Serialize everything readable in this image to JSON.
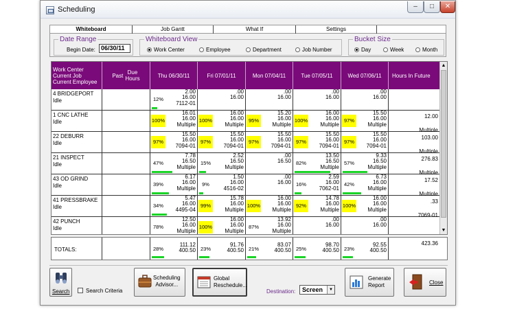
{
  "window": {
    "title": "Scheduling",
    "min": "–",
    "max": "□",
    "close": "✕"
  },
  "tabs": [
    {
      "label": "Whiteboard"
    },
    {
      "label": "Job Gantt"
    },
    {
      "label": "What If"
    },
    {
      "label": "Settings"
    }
  ],
  "date_range": {
    "legend": "Date Range",
    "begin_label": "Begin Date:",
    "begin_value": "06/30/11"
  },
  "view": {
    "legend": "Whiteboard View",
    "options": [
      "Work Center",
      "Employee",
      "Department",
      "Job Number"
    ],
    "selected": "Work Center"
  },
  "bucket": {
    "legend": "Bucket Size",
    "options": [
      "Day",
      "Week",
      "Month"
    ],
    "selected": "Day"
  },
  "grid": {
    "header": {
      "col0": [
        "Work Center",
        "Current Job",
        "Current Employee"
      ],
      "past": "Past",
      "due_hours": [
        "Due",
        "Hours"
      ],
      "days": [
        "Thu 06/30/11",
        "Fri 07/01/11",
        "Mon 07/04/11",
        "Tue 07/05/11",
        "Wed 07/06/11"
      ],
      "future": "Hours In Future"
    },
    "rows": [
      {
        "name": "4 BRIDGEPORT",
        "status": "Idle",
        "days": [
          {
            "pct": "12%",
            "pct_value": 0.12,
            "hl": false,
            "bar": true,
            "l": [
              "2.00",
              "16.00",
              "7112-01"
            ]
          },
          {
            "pct": "",
            "pct_value": 0,
            "hl": false,
            "bar": false,
            "l": [
              ".00",
              "16.00"
            ]
          },
          {
            "pct": "",
            "pct_value": 0,
            "hl": false,
            "bar": false,
            "l": [
              ".00",
              "16.00"
            ]
          },
          {
            "pct": "",
            "pct_value": 0,
            "hl": false,
            "bar": false,
            "l": [
              ".00",
              "16.00"
            ]
          },
          {
            "pct": "",
            "pct_value": 0,
            "hl": false,
            "bar": false,
            "l": [
              ".00",
              "16.00"
            ]
          }
        ],
        "future": []
      },
      {
        "name": "1 CNC LATHE",
        "status": "Idle",
        "days": [
          {
            "pct": "100%",
            "pct_value": 1.0,
            "hl": true,
            "bar": false,
            "l": [
              "16.01",
              "16.00",
              "Multiple"
            ]
          },
          {
            "pct": "100%",
            "pct_value": 1.0,
            "hl": true,
            "bar": false,
            "l": [
              "16.00",
              "16.00",
              "Multiple"
            ]
          },
          {
            "pct": "95%",
            "pct_value": 0.95,
            "hl": true,
            "bar": false,
            "l": [
              "15.20",
              "16.00",
              "Multiple"
            ]
          },
          {
            "pct": "100%",
            "pct_value": 1.0,
            "hl": true,
            "bar": false,
            "l": [
              "16.00",
              "16.00",
              "Multiple"
            ]
          },
          {
            "pct": "97%",
            "pct_value": 0.97,
            "hl": true,
            "bar": false,
            "l": [
              "15.50",
              "16.00",
              "Multiple"
            ]
          }
        ],
        "future": [
          "12.00",
          "",
          "Multiple"
        ]
      },
      {
        "name": "22 DEBURR",
        "status": "Idle",
        "days": [
          {
            "pct": "97%",
            "pct_value": 0.97,
            "hl": true,
            "bar": false,
            "l": [
              "15.50",
              "16.00",
              "7094-01"
            ]
          },
          {
            "pct": "97%",
            "pct_value": 0.97,
            "hl": true,
            "bar": false,
            "l": [
              "15.50",
              "16.00",
              "7094-01"
            ]
          },
          {
            "pct": "97%",
            "pct_value": 0.97,
            "hl": true,
            "bar": false,
            "l": [
              "15.50",
              "16.00",
              "7094-01"
            ]
          },
          {
            "pct": "97%",
            "pct_value": 0.97,
            "hl": true,
            "bar": false,
            "l": [
              "15.50",
              "16.00",
              "7094-01"
            ]
          },
          {
            "pct": "97%",
            "pct_value": 0.97,
            "hl": true,
            "bar": false,
            "l": [
              "15.50",
              "16.00",
              "7094-01"
            ]
          }
        ],
        "future": [
          "103.00",
          "",
          "Multiple"
        ]
      },
      {
        "name": "21 INSPECT",
        "status": "Idle",
        "days": [
          {
            "pct": "47%",
            "pct_value": 0.47,
            "hl": false,
            "bar": true,
            "l": [
              "7.78",
              "16.50",
              "Multiple"
            ]
          },
          {
            "pct": "15%",
            "pct_value": 0.15,
            "hl": false,
            "bar": true,
            "l": [
              "2.52",
              "16.50",
              "Multiple"
            ]
          },
          {
            "pct": "",
            "pct_value": 0,
            "hl": false,
            "bar": false,
            "l": [
              ".00",
              "16.50"
            ]
          },
          {
            "pct": "82%",
            "pct_value": 0.82,
            "hl": false,
            "bar": true,
            "l": [
              "13.50",
              "16.50",
              "Multiple"
            ]
          },
          {
            "pct": "57%",
            "pct_value": 0.57,
            "hl": false,
            "bar": true,
            "l": [
              "9.33",
              "16.50",
              "Multiple"
            ]
          }
        ],
        "future": [
          "276.83",
          "",
          "Multiple"
        ]
      },
      {
        "name": "43 OD GRIND",
        "status": "Idle",
        "days": [
          {
            "pct": "39%",
            "pct_value": 0.39,
            "hl": false,
            "bar": true,
            "l": [
              "6.17",
              "16.00",
              "Multiple"
            ]
          },
          {
            "pct": "9%",
            "pct_value": 0.09,
            "hl": false,
            "bar": true,
            "l": [
              "1.50",
              "16.00",
              "4516-02"
            ]
          },
          {
            "pct": "",
            "pct_value": 0,
            "hl": false,
            "bar": false,
            "l": [
              ".00",
              "16.00"
            ]
          },
          {
            "pct": "16%",
            "pct_value": 0.16,
            "hl": false,
            "bar": true,
            "l": [
              "2.59",
              "16.00",
              "7062-01"
            ]
          },
          {
            "pct": "42%",
            "pct_value": 0.42,
            "hl": false,
            "bar": true,
            "l": [
              "6.73",
              "16.00",
              "Multiple"
            ]
          }
        ],
        "future": [
          "17.52",
          "",
          "Multiple"
        ]
      },
      {
        "name": "41 PRESSBRAKE",
        "status": "Idle",
        "days": [
          {
            "pct": "34%",
            "pct_value": 0.34,
            "hl": false,
            "bar": true,
            "l": [
              "5.47",
              "16.00",
              "4495-04"
            ]
          },
          {
            "pct": "99%",
            "pct_value": 0.99,
            "hl": true,
            "bar": false,
            "l": [
              "15.78",
              "16.00",
              "Multiple"
            ]
          },
          {
            "pct": "100%",
            "pct_value": 1.0,
            "hl": true,
            "bar": false,
            "l": [
              "16.00",
              "16.00",
              "Multiple"
            ]
          },
          {
            "pct": "92%",
            "pct_value": 0.92,
            "hl": true,
            "bar": false,
            "l": [
              "14.78",
              "16.00",
              "Multiple"
            ]
          },
          {
            "pct": "100%",
            "pct_value": 1.0,
            "hl": true,
            "bar": false,
            "l": [
              "16.00",
              "16.00",
              "Multiple"
            ]
          }
        ],
        "future": [
          ".33",
          "",
          "7069-01"
        ]
      },
      {
        "name": "42 PUNCH",
        "status": "Idle",
        "days": [
          {
            "pct": "78%",
            "pct_value": 0.78,
            "hl": false,
            "bar": true,
            "l": [
              "12.50",
              "16.00",
              "Multiple"
            ]
          },
          {
            "pct": "100%",
            "pct_value": 1.0,
            "hl": true,
            "bar": false,
            "l": [
              "16.00",
              "16.00",
              "Multiple"
            ]
          },
          {
            "pct": "87%",
            "pct_value": 0.87,
            "hl": false,
            "bar": true,
            "l": [
              "13.92",
              "16.00",
              "Multiple"
            ]
          },
          {
            "pct": "",
            "pct_value": 0,
            "hl": false,
            "bar": false,
            "l": [
              ".00",
              "16.00"
            ]
          },
          {
            "pct": "",
            "pct_value": 0,
            "hl": false,
            "bar": false,
            "l": [
              ".00",
              "16.00"
            ]
          }
        ],
        "future": []
      }
    ]
  },
  "totals": {
    "label": "TOTALS:",
    "days": [
      {
        "pct": "28%",
        "pct_value": 0.28,
        "l": [
          "111.12",
          "400.50"
        ]
      },
      {
        "pct": "23%",
        "pct_value": 0.23,
        "l": [
          "91.76",
          "400.50"
        ]
      },
      {
        "pct": "21%",
        "pct_value": 0.21,
        "l": [
          "83.07",
          "400.50"
        ]
      },
      {
        "pct": "25%",
        "pct_value": 0.25,
        "l": [
          "98.70",
          "400.50"
        ]
      },
      {
        "pct": "23%",
        "pct_value": 0.23,
        "l": [
          "92.55",
          "400.50"
        ]
      }
    ],
    "future": "423.36"
  },
  "buttons": {
    "search": "Search",
    "search_criteria": "Search Criteria",
    "advisor": [
      "Scheduling",
      "Advisor..."
    ],
    "global": [
      "Global",
      "Reschedule..."
    ],
    "destination_label": "Destination:",
    "destination_value": "Screen",
    "generate": [
      "Generate",
      "Report"
    ],
    "close": "Close"
  },
  "colors": {
    "header_purple": "#7a0a7a",
    "highlight": "#ffff00",
    "bar_green": "#19d426",
    "label_purple": "#6a2a8a"
  }
}
